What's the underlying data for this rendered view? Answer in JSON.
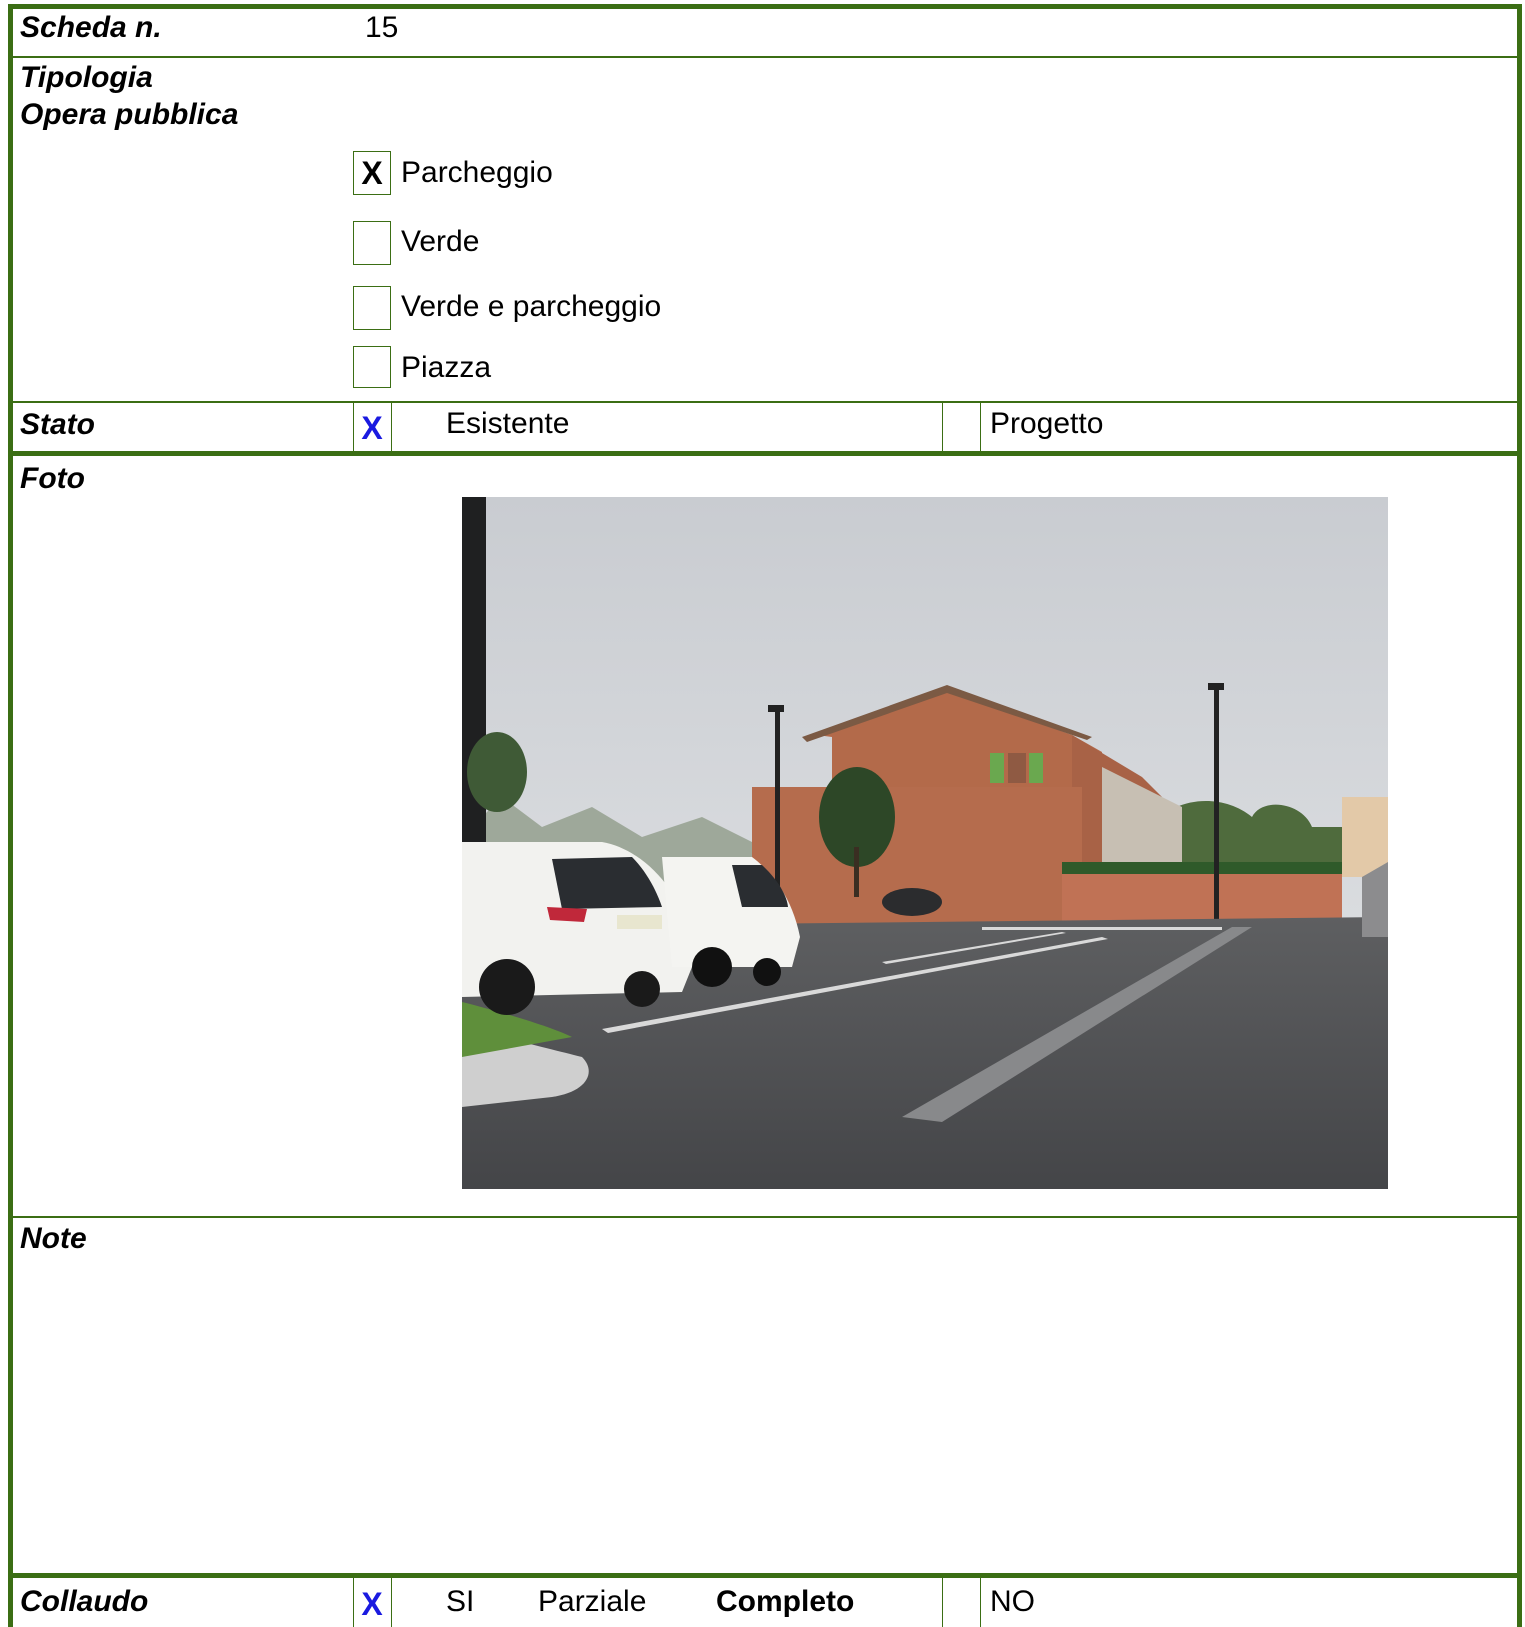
{
  "scheda": {
    "label": "Scheda n.",
    "value": "15"
  },
  "tipologia": {
    "label_line1": "Tipologia",
    "label_line2": "Opera pubblica",
    "options": [
      {
        "mark": "X",
        "label": "Parcheggio",
        "checked": true
      },
      {
        "mark": "",
        "label": "Verde",
        "checked": false
      },
      {
        "mark": "",
        "label": "Verde e parcheggio",
        "checked": false
      },
      {
        "mark": "",
        "label": "Piazza",
        "checked": false
      }
    ]
  },
  "stato": {
    "label": "Stato",
    "mark": "X",
    "option_existing": "Esistente",
    "option_project": "Progetto"
  },
  "foto": {
    "label": "Foto"
  },
  "note": {
    "label": "Note"
  },
  "collaudo": {
    "label": "Collaudo",
    "mark": "X",
    "si": "SI",
    "parziale": "Parziale",
    "completo": "Completo",
    "no": "NO"
  },
  "colors": {
    "border": "#3b6e14",
    "mark_blue": "#1a1ae0"
  }
}
